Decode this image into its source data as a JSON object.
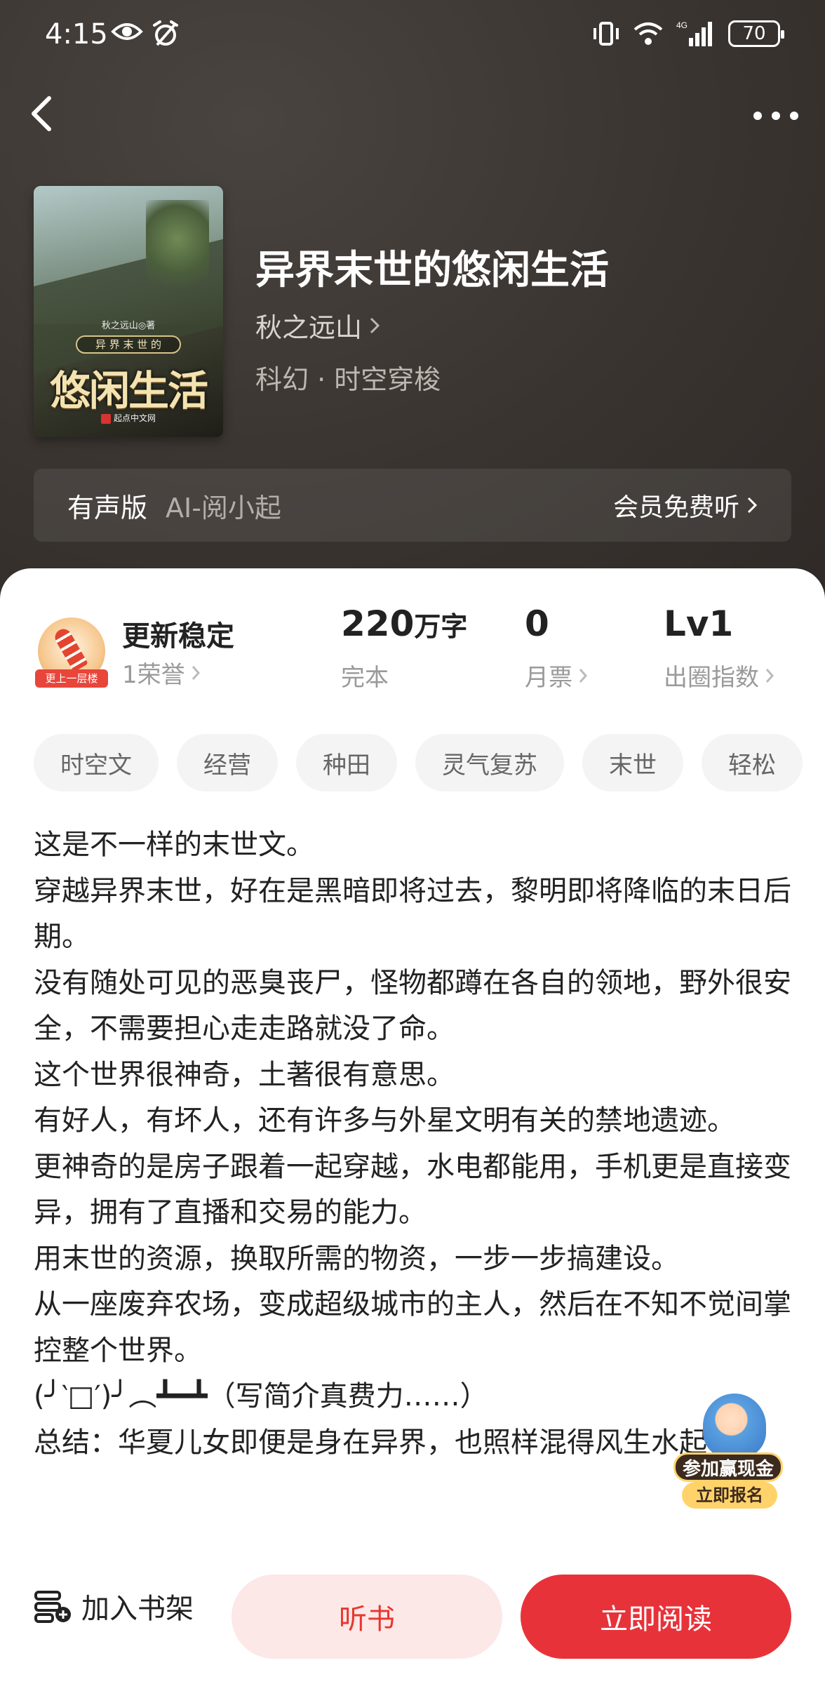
{
  "status_bar": {
    "time": "4:15",
    "battery": "70"
  },
  "book": {
    "title": "异界末世的悠闲生活",
    "author": "秋之远山",
    "genre": "科幻 · 时空穿梭",
    "cover": {
      "author_line": "秋之远山◎著",
      "subtitle": "异 界 末 世 的",
      "title": "悠闲生活",
      "publisher": "起点中文网"
    }
  },
  "audio": {
    "label": "有声版",
    "narrator": "AI-阅小起",
    "action": "会员免费听"
  },
  "honor": {
    "badge_text": "更上一层楼",
    "title": "更新稳定",
    "count": "1荣誉"
  },
  "stats": {
    "words_value": "220",
    "words_unit": "万字",
    "status": "完本",
    "tickets_value": "0",
    "tickets_label": "月票",
    "level_value": "Lv1",
    "level_label": "出圈指数"
  },
  "tags": [
    "时空文",
    "经营",
    "种田",
    "灵气复苏",
    "末世",
    "轻松"
  ],
  "description": [
    "这是不一样的末世文。",
    "穿越异界末世，好在是黑暗即将过去，黎明即将降临的末日后期。",
    "没有随处可见的恶臭丧尸，怪物都蹲在各自的领地，野外很安全，不需要担心走走路就没了命。",
    "这个世界很神奇，土著很有意思。",
    "有好人，有坏人，还有许多与外星文明有关的禁地遗迹。",
    "更神奇的是房子跟着一起穿越，水电都能用，手机更是直接变异，拥有了直播和交易的能力。",
    "用末世的资源，换取所需的物资，一步一步搞建设。",
    "从一座废弃农场，变成超级城市的主人，然后在不知不觉间掌控整个世界。",
    "(╯‵□′)╯︵┻━┻（写简介真费力……）",
    "总结：华夏儿女即便是身在异界，也照样混得风生水起！"
  ],
  "promo": {
    "line1": "参加赢现金",
    "line2": "立即报名"
  },
  "bottom": {
    "shelf_label": "加入书架",
    "listen_label": "听书",
    "read_label": "立即阅读"
  },
  "colors": {
    "accent": "#e8323a",
    "accent_light": "#fce8e7",
    "header_bg": "#3b3531"
  }
}
